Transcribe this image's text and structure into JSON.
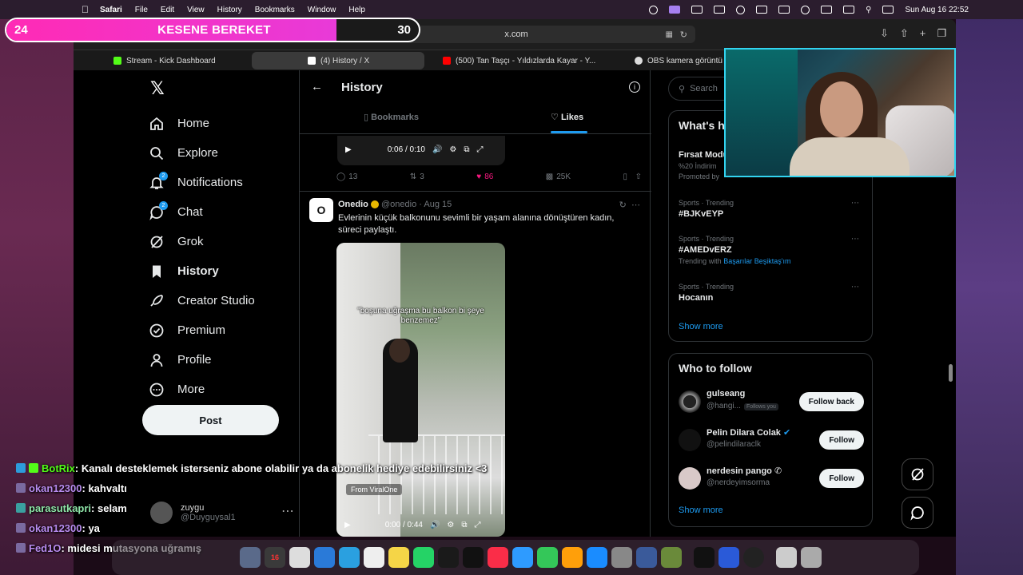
{
  "menubar": {
    "app": "Safari",
    "items": [
      "File",
      "Edit",
      "View",
      "History",
      "Bookmarks",
      "Window",
      "Help"
    ],
    "datetime": "Sun Aug 16  22:52"
  },
  "browser": {
    "url": "x.com",
    "tabs": [
      {
        "label": "Stream - Kick Dashboard",
        "color": "#53fc18"
      },
      {
        "label": "(4) History / X",
        "color": "#ffffff"
      },
      {
        "label": "(500) Tan Taşçı - Yıldızlarda Kayar - Y...",
        "color": "#ff0000"
      },
      {
        "label": "OBS kamera görüntü",
        "color": "#dddddd"
      }
    ]
  },
  "nav": {
    "items": [
      {
        "label": "Home",
        "icon": "home-icon"
      },
      {
        "label": "Explore",
        "icon": "search-icon"
      },
      {
        "label": "Notifications",
        "icon": "bell-icon",
        "badge": "2"
      },
      {
        "label": "Chat",
        "icon": "chat-icon",
        "badge": "2"
      },
      {
        "label": "Grok",
        "icon": "grok-icon"
      },
      {
        "label": "History",
        "icon": "bookmark-icon"
      },
      {
        "label": "Creator Studio",
        "icon": "rocket-icon"
      },
      {
        "label": "Premium",
        "icon": "verified-icon"
      },
      {
        "label": "Profile",
        "icon": "person-icon"
      },
      {
        "label": "More",
        "icon": "more-icon"
      }
    ],
    "post": "Post",
    "account": {
      "name": "zuygu",
      "handle": "@Duyguysal1"
    }
  },
  "history": {
    "title": "History",
    "tab_bookmarks": "Bookmarks",
    "tab_likes": "Likes",
    "video1_time": "0:06 / 0:10",
    "tweet1_actions": {
      "replies": "13",
      "reposts": "3",
      "likes": "86",
      "views": "25K"
    },
    "tweet2": {
      "name": "Onedio",
      "handle": "@onedio",
      "date": "Aug 15",
      "text": "Evlerinin küçük balkonunu sevimli bir yaşam alanına dönüştüren kadın, süreci paylaştı.",
      "caption": "\"boşuna uğraşma bu balkon bi şeye benzemez\"",
      "from": "From  ViralOne",
      "time": "0:00 / 0:44"
    }
  },
  "right": {
    "search": "Search",
    "whats": "What's h",
    "promo": {
      "title": "Fırsat Modu",
      "sub": "%20 İndirim",
      "note": "Promoted by"
    },
    "trends": [
      {
        "meta": "Sports · Trending",
        "name": "#BJKvEYP",
        "sub": "",
        "link": ""
      },
      {
        "meta": "Sports · Trending",
        "name": "#AMEDvERZ",
        "sub": "Trending with",
        "link": "Başarılar Beşiktaş'ım"
      },
      {
        "meta": "Sports · Trending",
        "name": "Hocanın",
        "sub": "",
        "link": ""
      }
    ],
    "show_more": "Show more",
    "who_title": "Who to follow",
    "who": [
      {
        "name": "gulseang",
        "handle": "@hangi...",
        "follows_you": "Follows you",
        "button": "Follow back"
      },
      {
        "name": "Pelin Dilara Colak",
        "handle": "@pelindilaraclk",
        "follows_you": "",
        "button": "Follow"
      },
      {
        "name": "nerdesin pango",
        "handle": "@nerdeyimsorma",
        "follows_you": "",
        "button": "Follow"
      }
    ],
    "show_more2": "Show more"
  },
  "stream": {
    "goal_left": "24",
    "goal_title": "KESENE BEREKET",
    "goal_right": "30",
    "goal_progress": 0.8
  },
  "chat": [
    {
      "user": "BotRix",
      "msg": ": Kanalı desteklemek isterseniz abone olabilir ya da abonelik hediye edebilirsiniz <3"
    },
    {
      "user": "okan12300",
      "msg": ": kahvaltı"
    },
    {
      "user": "parasutkapri",
      "msg": ": selam"
    },
    {
      "user": "okan12300",
      "msg": ": ya"
    },
    {
      "user": "Fed1O",
      "msg": ": midesi mutasyona uğramış"
    }
  ],
  "dock": {
    "calendar_day": "16"
  },
  "colors": {
    "accent": "#1d9bf0",
    "like": "#f91880",
    "kick": "#53fc18",
    "goal": "#ff2bb5",
    "webcam_border": "#32d4f0"
  }
}
